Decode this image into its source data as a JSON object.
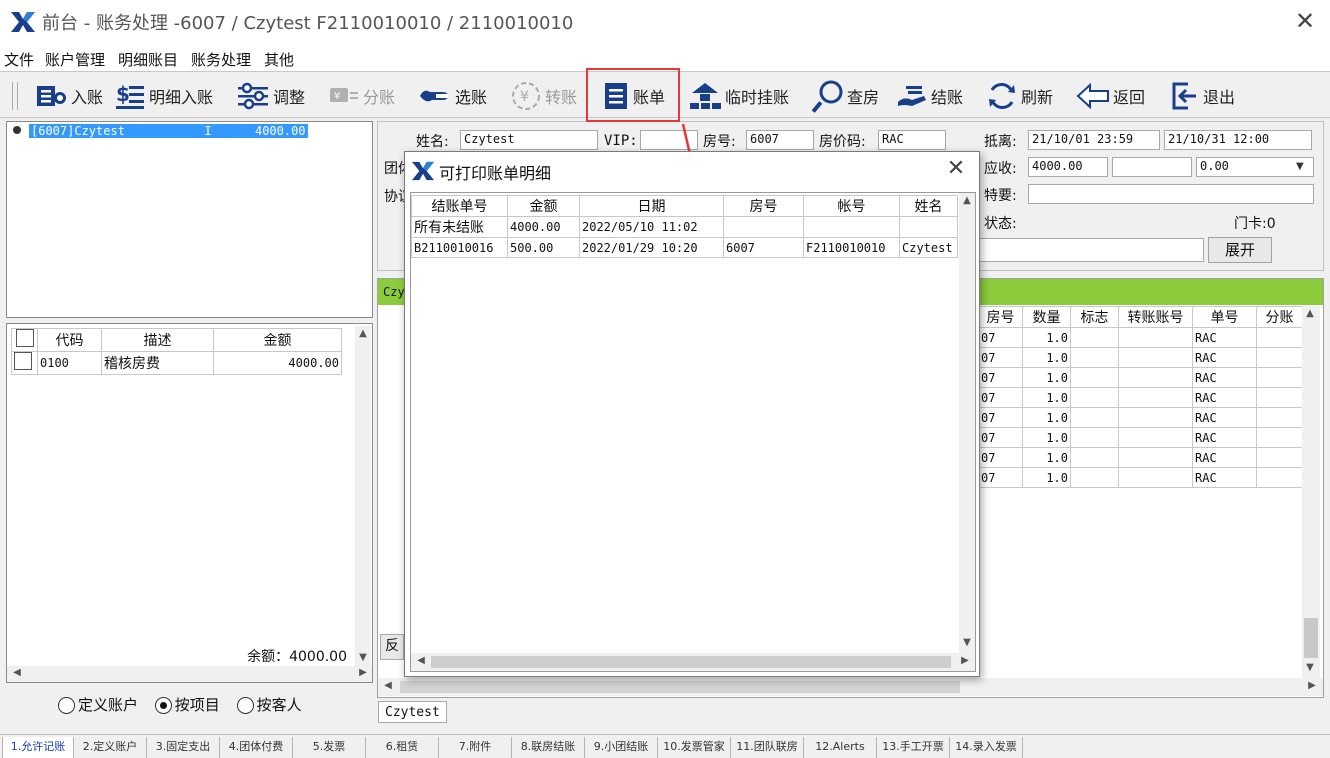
{
  "window": {
    "title": "前台 - 账务处理 -6007  /  Czytest  F2110010010  /  2110010010",
    "close_glyph": "✕"
  },
  "menu": [
    "文件",
    "账户管理",
    "明细账目",
    "账务处理",
    "其他"
  ],
  "toolbar": [
    {
      "label": "入账",
      "icon": "post-entry-icon",
      "enabled": true
    },
    {
      "label": "明细入账",
      "icon": "detail-entry-icon",
      "enabled": true
    },
    {
      "label": "调整",
      "icon": "adjust-sliders-icon",
      "enabled": true
    },
    {
      "label": "分账",
      "icon": "split-account-icon",
      "enabled": false
    },
    {
      "label": "选账",
      "icon": "select-account-icon",
      "enabled": true
    },
    {
      "label": "转账",
      "icon": "transfer-yen-icon",
      "enabled": false
    },
    {
      "label": "账单",
      "icon": "bill-list-icon",
      "enabled": true
    },
    {
      "label": "临时挂账",
      "icon": "temporary-hold-icon",
      "enabled": true
    },
    {
      "label": "查房",
      "icon": "room-check-icon",
      "enabled": true
    },
    {
      "label": "结账",
      "icon": "checkout-icon",
      "enabled": true
    },
    {
      "label": "刷新",
      "icon": "refresh-icon",
      "enabled": true
    },
    {
      "label": "返回",
      "icon": "back-arrow-icon",
      "enabled": true
    },
    {
      "label": "退出",
      "icon": "exit-icon",
      "enabled": true
    }
  ],
  "account_tree": {
    "item": "[6007]Czytest           I      4000.00"
  },
  "items_table": {
    "headers": [
      "代码",
      "描述",
      "金额"
    ],
    "rows": [
      {
        "code": "0100",
        "desc": "稽核房费",
        "amount": "4000.00"
      }
    ],
    "balance": "余额：4000.00"
  },
  "view_mode": {
    "options": [
      "定义账户",
      "按项目",
      "按客人"
    ],
    "selected": "按项目"
  },
  "guest_info": {
    "name_label": "姓名:",
    "name": "Czytest",
    "vip_label": "VIP:",
    "vip": "",
    "room_label": "房号:",
    "room": "6007",
    "rate_code_label": "房价码:",
    "rate_code": "RAC",
    "group_label_partial": "团体",
    "agreement_label_partial": "协议",
    "arrive_depart_label": "抵离:",
    "arrive": "21/10/01 23:59",
    "depart": "21/10/31 12:00",
    "receivable_label": "应收:",
    "receivable": "4000.00",
    "receivable_2": "",
    "receivable_3": "0.00",
    "special_label": "特要:",
    "special": "",
    "status_label": "状态:",
    "door_card_label": "门卡:0",
    "expand_button": "展开"
  },
  "transactions": {
    "tab_label_partial": "Czy",
    "headers": [
      "房号",
      "数量",
      "标志",
      "转账账号",
      "单号",
      "分账"
    ],
    "room_partial": "07",
    "rows": [
      {
        "qty": "1.0",
        "doc": "RAC"
      },
      {
        "qty": "1.0",
        "doc": "RAC"
      },
      {
        "qty": "1.0",
        "doc": "RAC"
      },
      {
        "qty": "1.0",
        "doc": "RAC"
      },
      {
        "qty": "1.0",
        "doc": "RAC"
      },
      {
        "qty": "1.0",
        "doc": "RAC"
      },
      {
        "qty": "1.0",
        "doc": "RAC"
      },
      {
        "qty": "1.0",
        "doc": "RAC"
      }
    ],
    "reverse_partial": "反"
  },
  "bottom_guest_tab": "Czytest",
  "dialog": {
    "title": "可打印账单明细",
    "headers": [
      "结账单号",
      "金额",
      "日期",
      "房号",
      "帐号",
      "姓名"
    ],
    "rows": [
      {
        "bill_no": "所有未结账",
        "amount": "4000.00",
        "date": "2022/05/10 11:02",
        "room": "",
        "account": "",
        "name": ""
      },
      {
        "bill_no": "B2110010016",
        "amount": "500.00",
        "date": "2022/01/29 10:20",
        "room": "6007",
        "account": "F2110010010",
        "name": "Czytest"
      }
    ]
  },
  "bottom_tabs": [
    "1.允许记账",
    "2.定义账户",
    "3.固定支出",
    "4.团体付费",
    "5.发票",
    "6.租赁",
    "7.附件",
    "8.联房结账",
    "9.小团结账",
    "10.发票管家",
    "11.团队联房",
    "12.Alerts",
    "13.手工开票",
    "14.录入发票"
  ],
  "colors": {
    "highlight": "#e53935",
    "selection": "#3399ff",
    "tab_green": "#8ccc3c",
    "icon_blue": "#1a3f8a"
  }
}
